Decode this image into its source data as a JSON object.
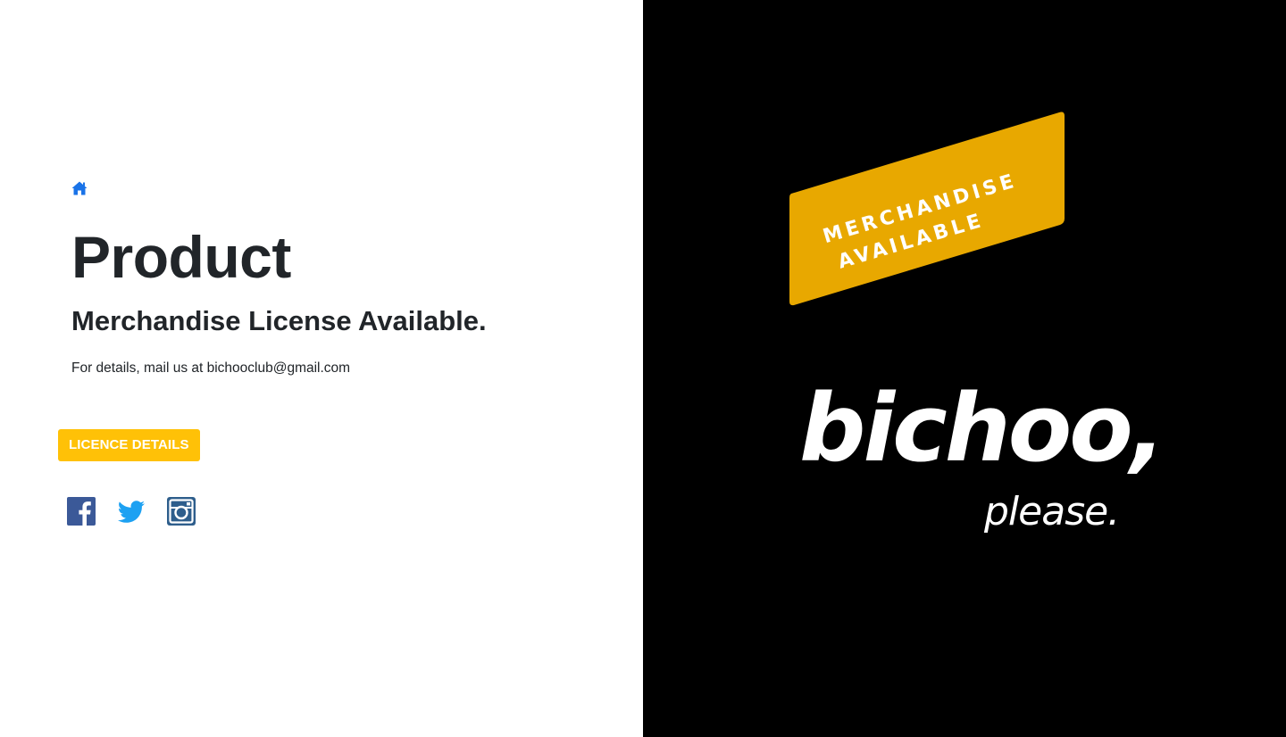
{
  "hero": {
    "title": "Product",
    "subtitle": "Merchandise License Available.",
    "details": "For details, mail us at bichooclub@gmail.com",
    "licence_button_label": "LICENCE DETAILS"
  },
  "social": {
    "facebook_icon": "facebook-icon",
    "twitter_icon": "twitter-icon",
    "instagram_icon": "instagram-icon"
  },
  "artwork": {
    "banner_line_1": "MERCHANDISE",
    "banner_line_2": "AVAILABLE",
    "brand_word": "bichoo,",
    "brand_tagline": "please."
  },
  "colors": {
    "accent_button": "#ffc107",
    "home_icon": "#1a73e8",
    "banner": "#e8a800",
    "facebook": "#3b5998",
    "twitter": "#1da1f2",
    "instagram": "#2e5e8c",
    "text": "#212529"
  }
}
